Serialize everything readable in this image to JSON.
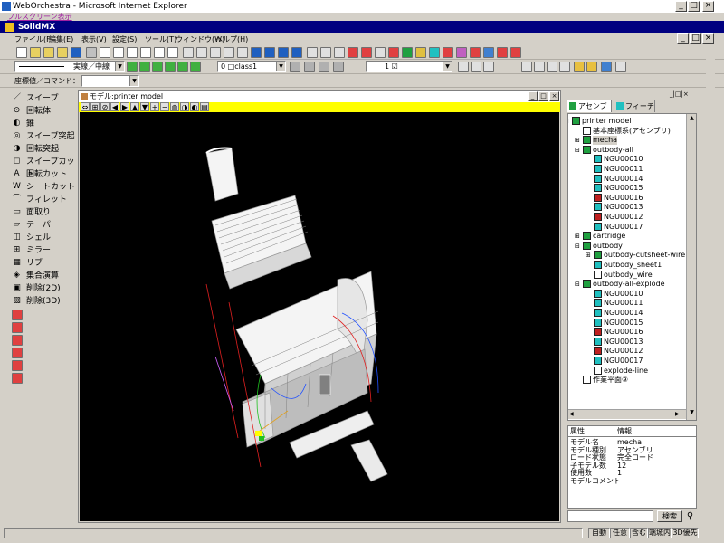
{
  "browser": {
    "title": "WebOrchestra - Microsoft Internet Explorer",
    "fullscreen_link": "フルスクリーン表示"
  },
  "app": {
    "title": "SolidMX"
  },
  "menu": [
    "ファイル(F)",
    "編集(E)",
    "表示(V)",
    "設定(S)",
    "ツール(T)",
    "ウィンドウ(W)",
    "ヘルプ(H)"
  ],
  "toolbar2": {
    "line_style": "実線／中線",
    "class_value": "0 □class1",
    "layer_value": "1 ☑"
  },
  "coord": {
    "label": "座標値／コマンド：",
    "value": ""
  },
  "left_tools": [
    "スイープ",
    "回転体",
    "錐",
    "スイープ突起",
    "回転突起",
    "スイープカット",
    "回転カット",
    "シートカット",
    "フィレット",
    "面取り",
    "テーパー",
    "シェル",
    "ミラー",
    "リブ",
    "集合演算",
    "削除(2D)",
    "削除(3D)"
  ],
  "left_icons": [
    "／",
    "⊙",
    "◐",
    "◎",
    "◑",
    "◻",
    "A",
    "W",
    "⌒",
    "▭",
    "▱",
    "◫",
    "⊞",
    "▦",
    "◈",
    "▣",
    "▨"
  ],
  "viewer": {
    "title": "モデル:printer  model"
  },
  "tabs": {
    "assembly": "アセンブリ",
    "feature": "フィーチャ"
  },
  "tree": [
    {
      "label": "printer  model",
      "depth": 0,
      "exp": "⊟",
      "color": "#20a040"
    },
    {
      "label": "基本座標系(アセンブリ)",
      "depth": 1,
      "exp": "",
      "color": "#ffffff"
    },
    {
      "label": "mecha",
      "depth": 1,
      "exp": "⊞",
      "color": "#20a040",
      "selected": true
    },
    {
      "label": "outbody-all",
      "depth": 1,
      "exp": "⊟",
      "color": "#20a040"
    },
    {
      "label": "NGU00010",
      "depth": 2,
      "exp": "",
      "color": "#20c0c0"
    },
    {
      "label": "NGU00011",
      "depth": 2,
      "exp": "",
      "color": "#20c0c0"
    },
    {
      "label": "NGU00014",
      "depth": 2,
      "exp": "",
      "color": "#20c0c0"
    },
    {
      "label": "NGU00015",
      "depth": 2,
      "exp": "",
      "color": "#20c0c0"
    },
    {
      "label": "NGU00016",
      "depth": 2,
      "exp": "",
      "color": "#c02020"
    },
    {
      "label": "NGU00013",
      "depth": 2,
      "exp": "",
      "color": "#20c0c0"
    },
    {
      "label": "NGU00012",
      "depth": 2,
      "exp": "",
      "color": "#c02020"
    },
    {
      "label": "NGU00017",
      "depth": 2,
      "exp": "",
      "color": "#20c0c0"
    },
    {
      "label": "cartridge",
      "depth": 1,
      "exp": "⊞",
      "color": "#20a040"
    },
    {
      "label": "outbody",
      "depth": 1,
      "exp": "⊟",
      "color": "#20a040"
    },
    {
      "label": "outbody-cutsheet-wire",
      "depth": 2,
      "exp": "⊞",
      "color": "#20a040"
    },
    {
      "label": "outbody_sheet1",
      "depth": 2,
      "exp": "",
      "color": "#20c0c0"
    },
    {
      "label": "outbody_wire",
      "depth": 2,
      "exp": "",
      "color": "#ffffff"
    },
    {
      "label": "outbody-all-explode",
      "depth": 1,
      "exp": "⊟",
      "color": "#20a040"
    },
    {
      "label": "NGU00010",
      "depth": 2,
      "exp": "",
      "color": "#20c0c0"
    },
    {
      "label": "NGU00011",
      "depth": 2,
      "exp": "",
      "color": "#20c0c0"
    },
    {
      "label": "NGU00014",
      "depth": 2,
      "exp": "",
      "color": "#20c0c0"
    },
    {
      "label": "NGU00015",
      "depth": 2,
      "exp": "",
      "color": "#20c0c0"
    },
    {
      "label": "NGU00016",
      "depth": 2,
      "exp": "",
      "color": "#c02020"
    },
    {
      "label": "NGU00013",
      "depth": 2,
      "exp": "",
      "color": "#20c0c0"
    },
    {
      "label": "NGU00012",
      "depth": 2,
      "exp": "",
      "color": "#c02020"
    },
    {
      "label": "NGU00017",
      "depth": 2,
      "exp": "",
      "color": "#20c0c0"
    },
    {
      "label": "explode-line",
      "depth": 2,
      "exp": "",
      "color": "#ffffff"
    },
    {
      "label": "作業平面⑨",
      "depth": 1,
      "exp": "",
      "color": "#ffffff"
    }
  ],
  "props": {
    "header": {
      "k": "属性",
      "v": "情報"
    },
    "rows": [
      {
        "k": "モデル名",
        "v": "mecha"
      },
      {
        "k": "モデル種別",
        "v": "アセンブリ"
      },
      {
        "k": "ロード状態",
        "v": "完全ロード"
      },
      {
        "k": "子モデル数",
        "v": "12"
      },
      {
        "k": "使用数",
        "v": "1"
      },
      {
        "k": "モデルコメント",
        "v": ""
      }
    ]
  },
  "search": {
    "button": "検索",
    "value": ""
  },
  "status": [
    "自動",
    "任意",
    "含む",
    "端城内",
    "3D優先"
  ],
  "colors": {
    "accent": "#000080",
    "viewer_toolbar": "#ffff00",
    "canvas": "#000000"
  }
}
